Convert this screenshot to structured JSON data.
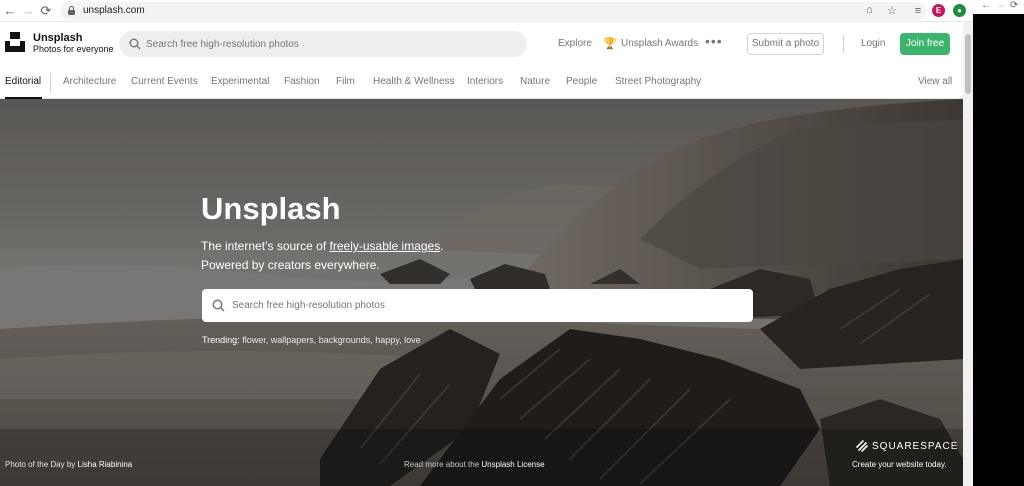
{
  "browser": {
    "url": "unsplash.com",
    "avatar_letter": "E"
  },
  "header": {
    "brand_name": "Unsplash",
    "brand_tagline": "Photos for everyone",
    "search_placeholder": "Search free high-resolution photos",
    "explore": "Explore",
    "awards": "Unsplash Awards",
    "more": "•••",
    "submit": "Submit a photo",
    "login": "Login",
    "join": "Join free"
  },
  "topics": {
    "items": [
      "Editorial",
      "Architecture",
      "Current Events",
      "Experimental",
      "Fashion",
      "Film",
      "Health & Wellness",
      "Interiors",
      "Nature",
      "People",
      "Street Photography"
    ],
    "active": "Editorial",
    "view_all": "View all"
  },
  "hero": {
    "title": "Unsplash",
    "subtitle_prefix": "The internet’s source of ",
    "subtitle_link": "freely-usable images",
    "subtitle_suffix": ".",
    "subtitle_line2": "Powered by creators everywhere.",
    "search_placeholder": "Search free high-resolution photos",
    "trending_label": "Trending:",
    "trending_terms": "flower, wallpapers, backgrounds, happy, love",
    "potd_prefix": "Photo of the Day",
    "potd_by": "by",
    "potd_author": "Lisha Riabinina",
    "license_prefix": "Read more about the",
    "license_link": "Unsplash License",
    "sponsor_name": "SQUARESPACE",
    "sponsor_tagline": "Create your website today."
  },
  "colors": {
    "join_button": "#3cb46e",
    "avatar": "#c2185b",
    "extension": "#1e8e3e"
  }
}
